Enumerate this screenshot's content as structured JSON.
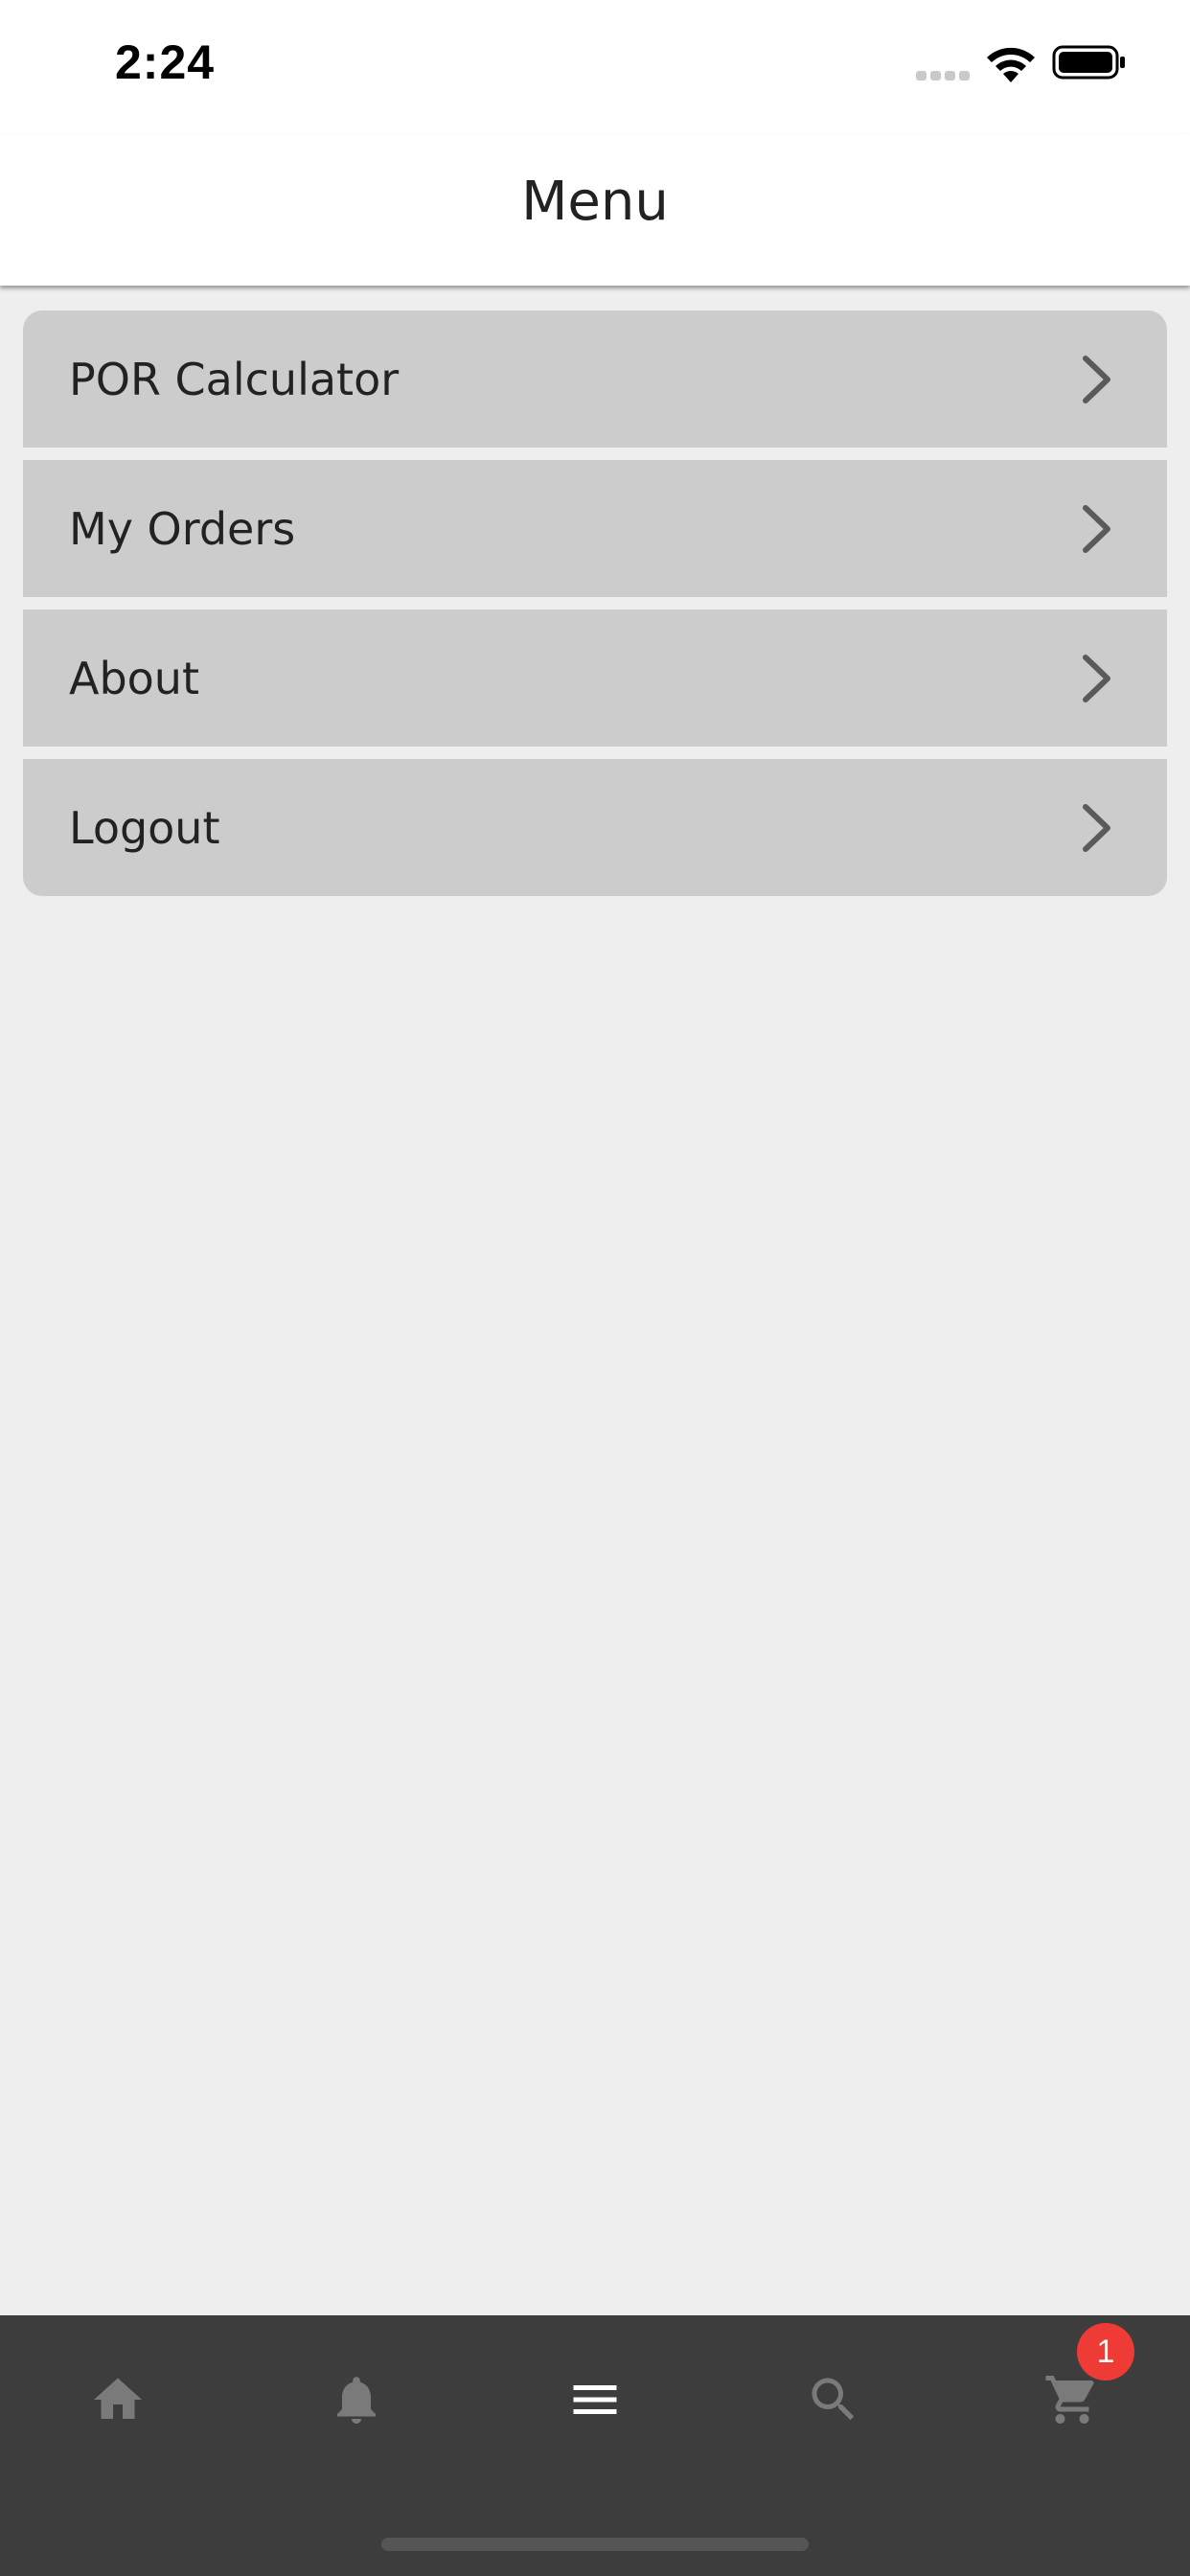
{
  "status_bar": {
    "time": "2:24"
  },
  "header": {
    "title": "Menu"
  },
  "menu": {
    "items": [
      {
        "label": "POR Calculator",
        "icon": "chevron-right-icon"
      },
      {
        "label": "My Orders",
        "icon": "chevron-right-icon"
      },
      {
        "label": "About",
        "icon": "chevron-right-icon"
      },
      {
        "label": "Logout",
        "icon": "chevron-right-icon"
      }
    ]
  },
  "tab_bar": {
    "tabs": [
      {
        "icon": "home-icon",
        "active": false
      },
      {
        "icon": "bell-icon",
        "active": false
      },
      {
        "icon": "menu-icon",
        "active": true
      },
      {
        "icon": "search-icon",
        "active": false
      },
      {
        "icon": "cart-icon",
        "active": false
      }
    ],
    "cart_badge": "1"
  },
  "colors": {
    "background": "#eeeeee",
    "menu_item": "#cccccc",
    "tab_bar": "#3d3d3e",
    "tab_icon_inactive": "#7a7a7a",
    "tab_icon_active": "#ffffff",
    "badge": "#ef3b36"
  }
}
